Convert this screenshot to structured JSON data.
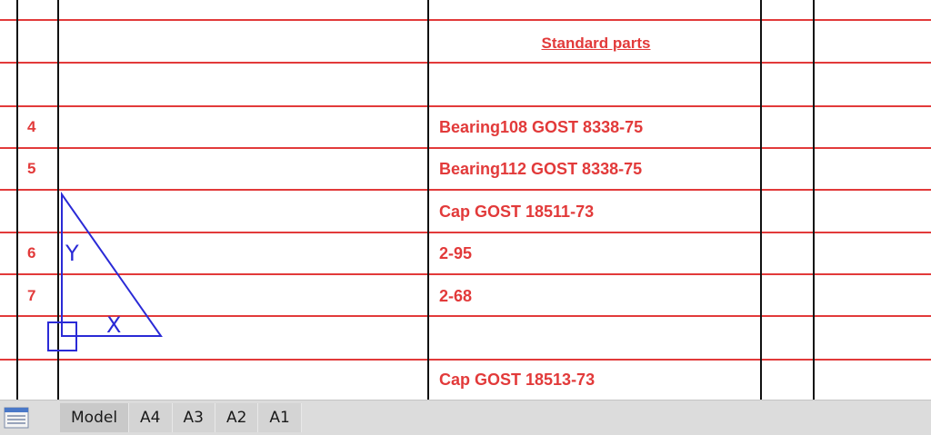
{
  "spec_table": {
    "section_title": "Standard parts",
    "rows": [
      {
        "pos": "4",
        "name": "Bearing108 GOST 8338-75"
      },
      {
        "pos": "5",
        "name": "Bearing112 GOST 8338-75"
      },
      {
        "pos": "",
        "name": "Cap GOST 18511-73"
      },
      {
        "pos": "6",
        "name": "2-95"
      },
      {
        "pos": "7",
        "name": "2-68"
      },
      {
        "pos": "",
        "name": ""
      },
      {
        "pos": "",
        "name": "Cap GOST 18513-73"
      }
    ]
  },
  "ucs_icon": {
    "y_label": "Y",
    "x_label": "X"
  },
  "layout_tabs": {
    "tabs": [
      "Model",
      "A4",
      "A3",
      "A2",
      "A1"
    ],
    "active": "Model"
  },
  "colors": {
    "table_red": "#e23a3a",
    "ucs_blue": "#2a2ad6",
    "frame_black": "#111111",
    "tabbar_bg": "#dcdcdc"
  },
  "icons": {
    "menu": "layout-menu-icon"
  }
}
